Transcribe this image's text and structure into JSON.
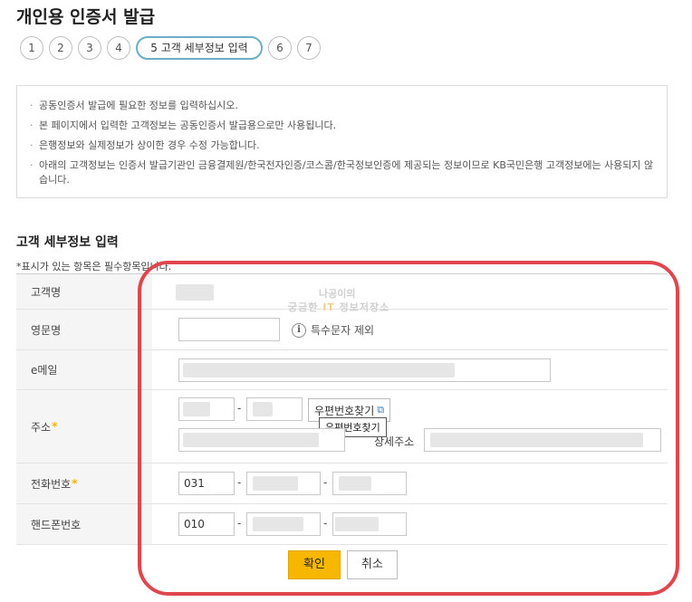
{
  "page": {
    "title": "개인용 인증서 발급"
  },
  "steps": [
    {
      "label": "1"
    },
    {
      "label": "2"
    },
    {
      "label": "3"
    },
    {
      "label": "4"
    },
    {
      "label": "5 고객 세부정보 입력"
    },
    {
      "label": "6"
    },
    {
      "label": "7"
    }
  ],
  "notice": {
    "items": [
      "공동인증서 발급에 필요한 정보를 입력하십시오.",
      "본 페이지에서 입력한 고객정보는 공동인증서 발급용으로만 사용됩니다.",
      "은행정보와 실제정보가 상이한 경우 수정 가능합니다.",
      "아래의 고객정보는 인증서 발급기관인 금융결제원/한국전자인증/코스콤/한국정보인증에 제공되는 정보이므로 KB국민은행 고객정보에는 사용되지 않습니다."
    ]
  },
  "section": {
    "title": "고객 세부정보 입력",
    "required_note": "*표시가 있는 항목은 필수항목입니다."
  },
  "form": {
    "name_label": "고객명",
    "eng_name_label": "영문명",
    "eng_name_hint": "특수문자 제외",
    "email_label": "e메일",
    "address_label": "주소",
    "zip_button": "우편번호찾기",
    "zip_tooltip": "우편번호찾기",
    "detail_address_label": "상세주소",
    "phone_label": "전화번호",
    "phone_prefix": "031",
    "mobile_label": "핸드폰번호",
    "mobile_prefix": "010",
    "required_mark": "*"
  },
  "buttons": {
    "confirm": "확인",
    "cancel": "취소"
  },
  "watermark": {
    "line1": "나공이의",
    "line2_prefix": "궁금한 ",
    "line2_it": "IT",
    "line2_suffix": " 정보저장소"
  },
  "colors": {
    "confirm_bg": "#f7b600",
    "highlight": "#e0464d",
    "step_active": "#6aaec8",
    "required_star": "#f5b400"
  }
}
